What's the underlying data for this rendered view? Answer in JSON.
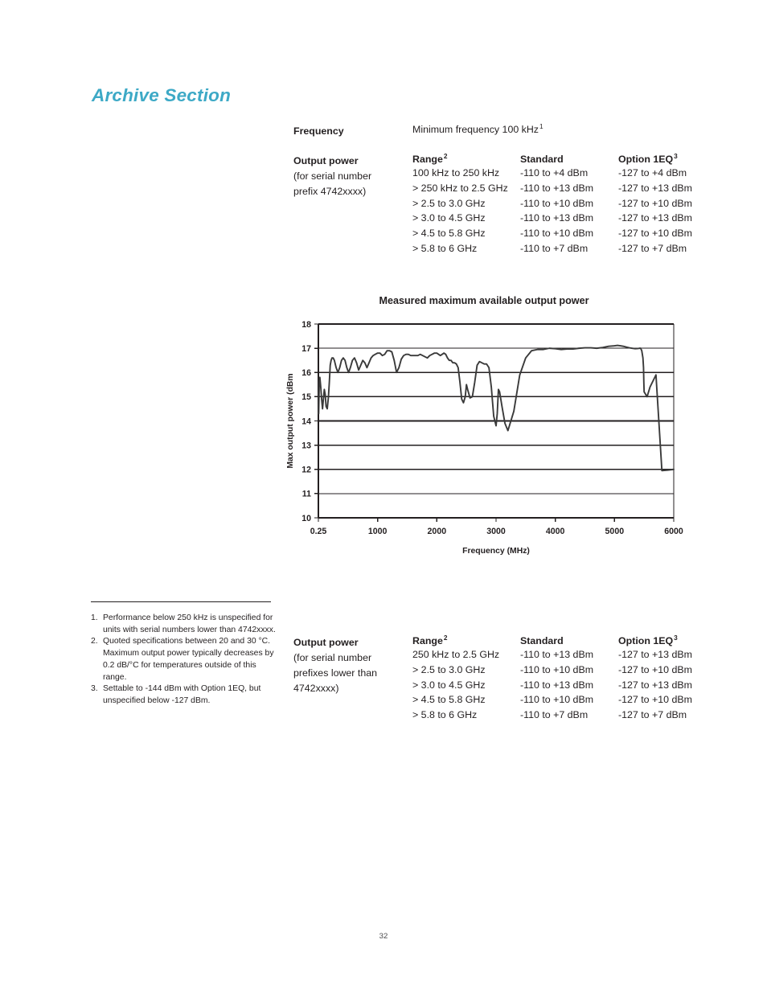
{
  "heading": "Archive Section",
  "accent_color": "#3da9c6",
  "ink_color": "#231f20",
  "frequency": {
    "label": "Frequency",
    "value_prefix": "Minimum frequency  100 kHz",
    "footnote_marker": "1"
  },
  "table_top": {
    "label_head": "Output power",
    "label_sub_1": "(for serial number",
    "label_sub_2": "prefix 4742xxxx)",
    "headers": {
      "range": "Range",
      "range_marker": "2",
      "standard": "Standard",
      "option": "Option 1EQ",
      "option_marker": "3"
    },
    "rows": [
      {
        "range": "100 kHz to 250 kHz",
        "standard": "-110 to +4 dBm",
        "option": "-127 to +4 dBm"
      },
      {
        "range": "> 250 kHz to 2.5 GHz",
        "standard": "-110 to +13 dBm",
        "option": "-127 to +13 dBm"
      },
      {
        "range": "> 2.5 to 3.0 GHz",
        "standard": "-110 to +10 dBm",
        "option": "-127 to +10 dBm"
      },
      {
        "range": "> 3.0 to 4.5 GHz",
        "standard": "-110 to +13 dBm",
        "option": "-127 to +13 dBm"
      },
      {
        "range": "> 4.5 to 5.8 GHz",
        "standard": "-110 to +10 dBm",
        "option": "-127 to +10 dBm"
      },
      {
        "range": "> 5.8 to 6 GHz",
        "standard": "-110 to +7 dBm",
        "option": "-127 to +7 dBm"
      }
    ]
  },
  "table_bottom": {
    "label_head": "Output power",
    "label_sub_1": "(for serial number",
    "label_sub_2": "prefixes lower than",
    "label_sub_3": "4742xxxx)",
    "headers": {
      "range": "Range",
      "range_marker": "2",
      "standard": "Standard",
      "option": "Option 1EQ",
      "option_marker": "3"
    },
    "rows": [
      {
        "range": "250 kHz to 2.5 GHz",
        "standard": "-110 to +13 dBm",
        "option": "-127 to +13 dBm"
      },
      {
        "range": "> 2.5 to 3.0 GHz",
        "standard": "-110 to +10 dBm",
        "option": "-127 to +10 dBm"
      },
      {
        "range": "> 3.0 to 4.5 GHz",
        "standard": "-110 to +13 dBm",
        "option": "-127 to +13 dBm"
      },
      {
        "range": "> 4.5 to 5.8 GHz",
        "standard": "-110 to +10 dBm",
        "option": "-127 to +10 dBm"
      },
      {
        "range": "> 5.8 to 6 GHz",
        "standard": "-110 to +7 dBm",
        "option": "-127 to +7 dBm"
      }
    ]
  },
  "footnotes": [
    {
      "num": "1.",
      "text": "Performance below 250 kHz is unspecified for units with serial numbers lower than 4742xxxx."
    },
    {
      "num": "2.",
      "text": "Quoted specifications between 20 and 30 °C. Maximum output power typically decreases by 0.2 dB/°C for temperatures outside of this range."
    },
    {
      "num": "3.",
      "text": "Settable to -144 dBm with Option 1EQ, but unspecified below -127 dBm."
    }
  ],
  "page_number": "32",
  "chart_data": {
    "type": "line",
    "title": "Measured maximum available output power",
    "xlabel": "Frequency (MHz)",
    "ylabel": "Max output power (dBm",
    "xlim": [
      0.25,
      6000
    ],
    "ylim": [
      10,
      18
    ],
    "xticks": [
      "0.25",
      "1000",
      "2000",
      "3000",
      "4000",
      "5000",
      "6000"
    ],
    "xtick_values": [
      0.25,
      1000,
      2000,
      3000,
      4000,
      5000,
      6000
    ],
    "yticks": [
      "10",
      "11",
      "12",
      "13",
      "14",
      "15",
      "16",
      "17",
      "18"
    ],
    "ytick_values": [
      10,
      11,
      12,
      13,
      14,
      15,
      16,
      17,
      18
    ],
    "grid": "horizontal",
    "legend": "none",
    "series": [
      {
        "name": "Max output power",
        "color": "#3a3a3a",
        "x": [
          5,
          15,
          25,
          40,
          55,
          70,
          85,
          100,
          115,
          130,
          150,
          170,
          185,
          200,
          215,
          230,
          250,
          270,
          300,
          330,
          360,
          390,
          420,
          450,
          480,
          510,
          540,
          575,
          610,
          645,
          680,
          715,
          750,
          785,
          820,
          855,
          890,
          925,
          960,
          1000,
          1040,
          1080,
          1120,
          1160,
          1200,
          1240,
          1280,
          1320,
          1360,
          1400,
          1440,
          1480,
          1520,
          1560,
          1600,
          1640,
          1680,
          1720,
          1760,
          1800,
          1840,
          1880,
          1920,
          1960,
          2000,
          2030,
          2060,
          2090,
          2120,
          2150,
          2180,
          2210,
          2240,
          2270,
          2300,
          2330,
          2360,
          2390,
          2420,
          2450,
          2480,
          2500,
          2520,
          2560,
          2600,
          2640,
          2680,
          2720,
          2760,
          2800,
          2840,
          2880,
          2920,
          2960,
          3000,
          3020,
          3040,
          3060,
          3100,
          3150,
          3200,
          3300,
          3400,
          3500,
          3600,
          3700,
          3800,
          3900,
          4000,
          4100,
          4200,
          4300,
          4400,
          4500,
          4600,
          4700,
          4800,
          4900,
          5000,
          5050,
          5100,
          5150,
          5200,
          5250,
          5300,
          5350,
          5400,
          5420,
          5440,
          5460,
          5480,
          5490,
          5495,
          5500,
          5550,
          5600,
          5700,
          5800,
          5900,
          6000
        ],
        "y": [
          14.3,
          15.6,
          15.8,
          15.4,
          14.9,
          14.5,
          14.9,
          15.3,
          15.1,
          14.6,
          14.5,
          15.0,
          15.6,
          16.3,
          16.5,
          16.6,
          16.6,
          16.5,
          16.2,
          16.0,
          16.2,
          16.5,
          16.6,
          16.5,
          16.2,
          16.0,
          16.2,
          16.5,
          16.6,
          16.4,
          16.1,
          16.3,
          16.5,
          16.4,
          16.2,
          16.4,
          16.6,
          16.7,
          16.75,
          16.8,
          16.8,
          16.7,
          16.75,
          16.9,
          16.9,
          16.85,
          16.5,
          16.0,
          16.2,
          16.55,
          16.7,
          16.75,
          16.75,
          16.7,
          16.7,
          16.7,
          16.7,
          16.75,
          16.7,
          16.65,
          16.6,
          16.7,
          16.75,
          16.8,
          16.8,
          16.75,
          16.7,
          16.75,
          16.8,
          16.75,
          16.6,
          16.5,
          16.5,
          16.4,
          16.4,
          16.35,
          16.2,
          15.6,
          14.9,
          14.75,
          15.0,
          15.5,
          15.3,
          14.95,
          15.0,
          15.6,
          16.3,
          16.45,
          16.4,
          16.35,
          16.35,
          16.2,
          15.4,
          14.2,
          13.8,
          14.3,
          15.3,
          15.2,
          14.6,
          13.9,
          13.6,
          14.4,
          15.9,
          16.6,
          16.9,
          16.95,
          16.95,
          17.0,
          16.98,
          16.95,
          16.97,
          16.97,
          17.0,
          17.02,
          17.02,
          17.0,
          17.03,
          17.08,
          17.1,
          17.12,
          17.1,
          17.08,
          17.05,
          17.02,
          17.0,
          16.98,
          16.99,
          17.0,
          17.0,
          16.9,
          16.6,
          16.2,
          15.6,
          15.2,
          15.0,
          15.4,
          15.9,
          11.95,
          11.97,
          12.0,
          12.03,
          12.08,
          12.15,
          12.25
        ]
      }
    ]
  }
}
